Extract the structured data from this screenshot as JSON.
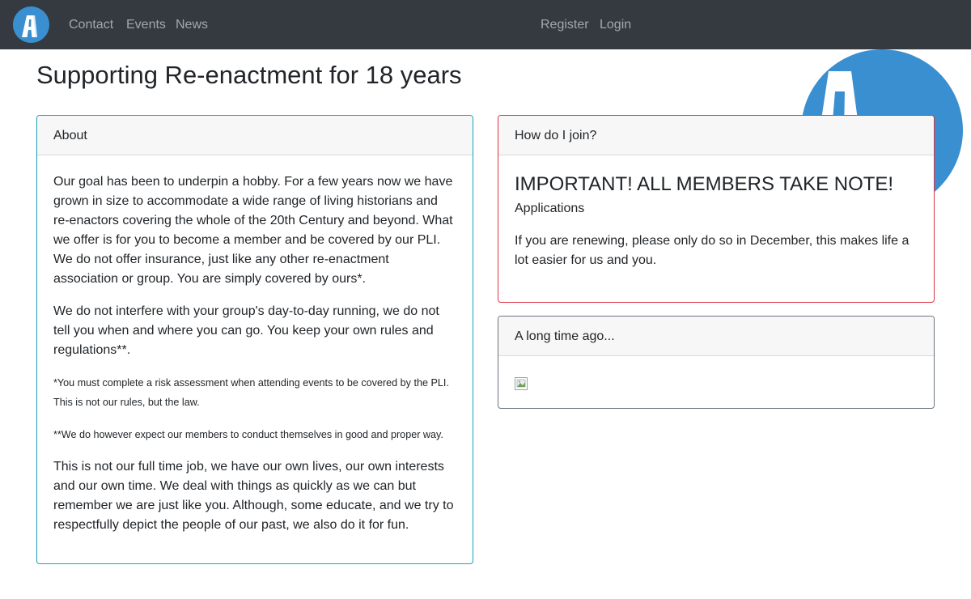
{
  "nav": {
    "logo_icon": "site-logo-a",
    "links": [
      "Contact",
      "Events",
      "News"
    ],
    "register": "Register",
    "login": "Login"
  },
  "page": {
    "title": "Supporting Re-enactment for 18 years"
  },
  "about": {
    "header": "About",
    "paragraphs": [
      "Our goal has been to underpin a hobby. For a few years now we have grown in size to accommodate a wide range of living historians and re-enactors covering the whole of the 20th Century and beyond. What we offer is for you to become a member and be covered by our PLI. We do not offer insurance, just like any other re-enactment association or group. You are simply covered by ours*.",
      "We do not interfere with your group's day-to-day running, we do not tell you when and where you can go. You keep your own rules and regulations**.",
      "*You must complete a risk assessment when attending events to be covered by the PLI. This is not our rules, but the law.",
      "**We do however expect our members to conduct themselves in good and proper way.",
      "This is not our full time job, we have our own lives, our own interests and our own time. We deal with things as quickly as we can but remember we are just like you. Although, some educate, and we try to respectfully depict the people of our past, we also do it for fun."
    ]
  },
  "join": {
    "header": "How do I join?",
    "title": "IMPORTANT! ALL MEMBERS TAKE NOTE!",
    "subtitle": "Applications",
    "text": "If you are renewing, please only do so in December, this makes life a lot easier for us and you."
  },
  "ago": {
    "header": "A long time ago...",
    "image_icon": "broken-image"
  },
  "colors": {
    "navbar": "#343a40",
    "brand_blue": "#3a8fd0",
    "about_border": "#17a2b8",
    "join_border": "#dc3545",
    "ago_border": "#6c757d"
  }
}
